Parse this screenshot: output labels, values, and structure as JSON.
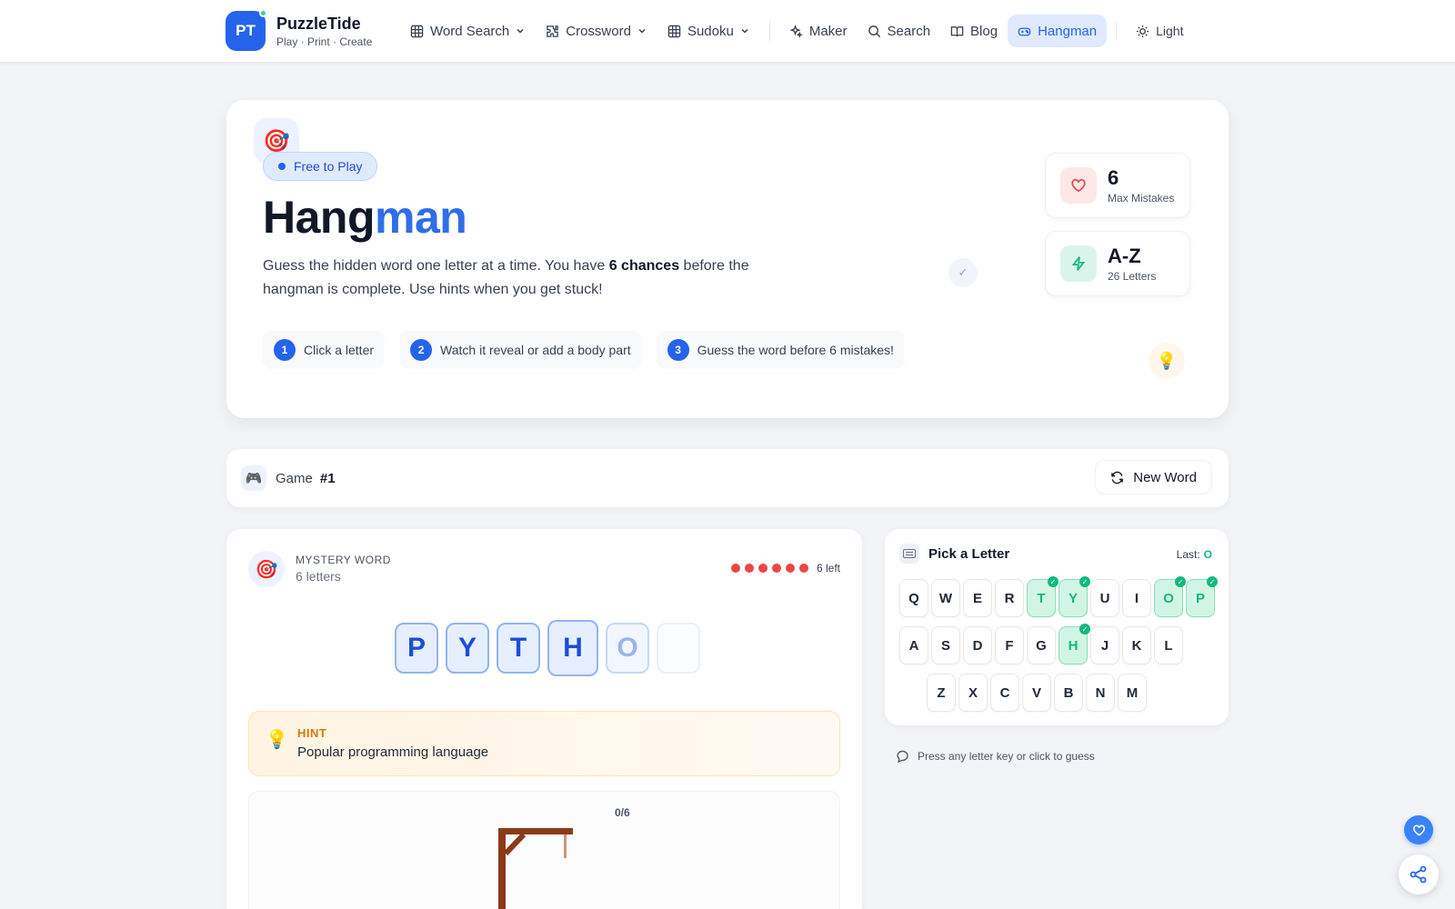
{
  "brand": {
    "initials": "PT",
    "name": "PuzzleTide",
    "tagline": "Play · Print · Create"
  },
  "nav": {
    "word_search": "Word Search",
    "crossword": "Crossword",
    "sudoku": "Sudoku",
    "maker": "Maker",
    "search": "Search",
    "blog": "Blog",
    "hangman": "Hangman",
    "theme": "Light"
  },
  "hero": {
    "pill": "Free to Play",
    "title_main": "Hang",
    "title_accent": "man",
    "desc_before": "Guess the hidden word one letter at a time. You have ",
    "desc_bold": "6 chances",
    "desc_after": " before the hangman is complete. Use hints when you get stuck!",
    "steps": [
      {
        "num": "1",
        "text": "Click a letter"
      },
      {
        "num": "2",
        "text": "Watch it reveal or add a body part"
      },
      {
        "num": "3",
        "text": "Guess the word before 6 mistakes!"
      }
    ],
    "check_mark": "✓",
    "stats": [
      {
        "value": "6",
        "label": "Max Mistakes",
        "icon": "heart-icon"
      },
      {
        "value": "A-Z",
        "label": "26 Letters",
        "icon": "bolt-icon"
      }
    ]
  },
  "gamebar": {
    "label": "Game",
    "number": "#1",
    "new_word": "New Word"
  },
  "word": {
    "title": "MYSTERY WORD",
    "subtitle": "6 letters",
    "lives_text": "6 left",
    "lives_remaining": 6,
    "tiles": [
      "P",
      "Y",
      "T",
      "H",
      "O",
      ""
    ],
    "hint_label": "HINT",
    "hint_text": "Popular programming language",
    "mistakes": "0/6"
  },
  "keyboard": {
    "title": "Pick a Letter",
    "last_label": "Last:",
    "last_value": "O",
    "rows": [
      [
        "Q",
        "W",
        "E",
        "R",
        "T",
        "Y",
        "U",
        "I",
        "O",
        "P"
      ],
      [
        "A",
        "S",
        "D",
        "F",
        "G",
        "H",
        "J",
        "K",
        "L"
      ],
      [
        "Z",
        "X",
        "C",
        "V",
        "B",
        "N",
        "M"
      ]
    ],
    "correct": [
      "T",
      "Y",
      "O",
      "P",
      "H"
    ],
    "help": "Press any letter key or click to guess"
  },
  "colors": {
    "accent": "#2563eb",
    "success": "#10b981",
    "danger": "#ef4444",
    "wood": "#8b3a1a"
  }
}
